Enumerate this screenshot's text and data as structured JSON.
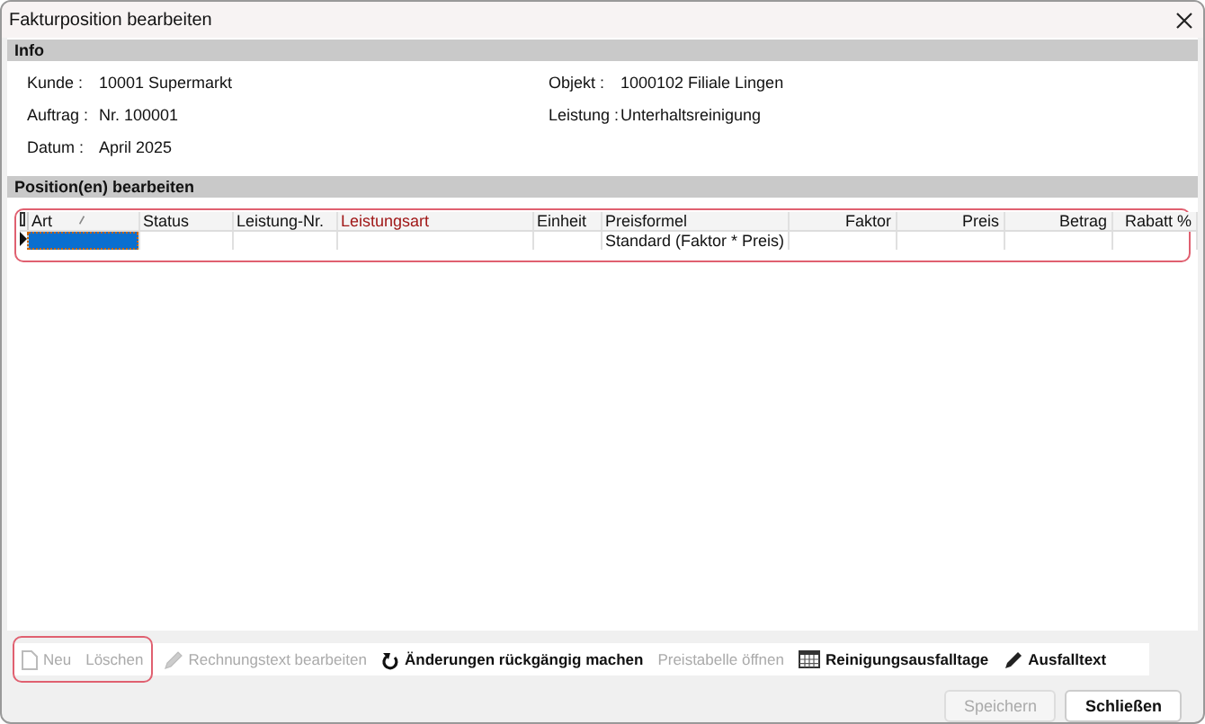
{
  "window": {
    "title": "Fakturposition bearbeiten"
  },
  "info": {
    "title": "Info",
    "fields": [
      {
        "label": "Kunde :",
        "value": "10001 Supermarkt"
      },
      {
        "label": "Objekt :",
        "value": "1000102 Filiale Lingen"
      },
      {
        "label": "Auftrag :",
        "value": "Nr. 100001"
      },
      {
        "label": "Leistung :",
        "value": "Unterhaltsreinigung"
      },
      {
        "label": "Datum :",
        "value": "April 2025"
      }
    ]
  },
  "positions": {
    "title": "Position(en) bearbeiten",
    "table": {
      "columns": [
        {
          "label": "Art",
          "required": false,
          "numeric": false,
          "sorted": true
        },
        {
          "label": "Status",
          "required": false,
          "numeric": false,
          "sorted": false
        },
        {
          "label": "Leistung-Nr.",
          "required": false,
          "numeric": false,
          "sorted": false
        },
        {
          "label": "Leistungsart",
          "required": true,
          "numeric": false,
          "sorted": false
        },
        {
          "label": "Einheit",
          "required": false,
          "numeric": false,
          "sorted": false
        },
        {
          "label": "Preisformel",
          "required": false,
          "numeric": false,
          "sorted": false
        },
        {
          "label": "Faktor",
          "required": false,
          "numeric": true,
          "sorted": false
        },
        {
          "label": "Preis",
          "required": false,
          "numeric": true,
          "sorted": false
        },
        {
          "label": "Betrag",
          "required": false,
          "numeric": true,
          "sorted": false
        },
        {
          "label": "Rabatt %",
          "required": false,
          "numeric": true,
          "sorted": false
        }
      ],
      "rows": [
        {
          "current": true,
          "cells": [
            {
              "selected": true
            },
            {
              "selected": false
            },
            {
              "selected": false
            },
            {
              "selected": false
            },
            {
              "selected": false
            },
            {
              "selected": false,
              "text": "Standard (Faktor * Preis)"
            },
            {
              "selected": false
            },
            {
              "selected": false
            },
            {
              "selected": false
            },
            {
              "selected": false
            }
          ]
        }
      ]
    }
  },
  "toolbar": [
    {
      "label": "Neu",
      "kind": "document",
      "disabled": true
    },
    {
      "label": "Löschen",
      "kind": "plain",
      "disabled": true
    },
    {
      "label": "Rechnungstext bearbeiten",
      "kind": "pencil",
      "disabled": true
    },
    {
      "label": "Änderungen rückgängig machen",
      "kind": "undo",
      "disabled": false
    },
    {
      "label": "Preistabelle öffnen",
      "kind": "plain",
      "disabled": true
    },
    {
      "label": "Reinigungsausfalltage",
      "kind": "calendar",
      "disabled": false
    },
    {
      "label": "Ausfalltext",
      "kind": "pen",
      "disabled": false
    }
  ],
  "buttons": [
    {
      "label": "Speichern",
      "disabled": true
    },
    {
      "label": "Schließen",
      "disabled": false
    }
  ]
}
